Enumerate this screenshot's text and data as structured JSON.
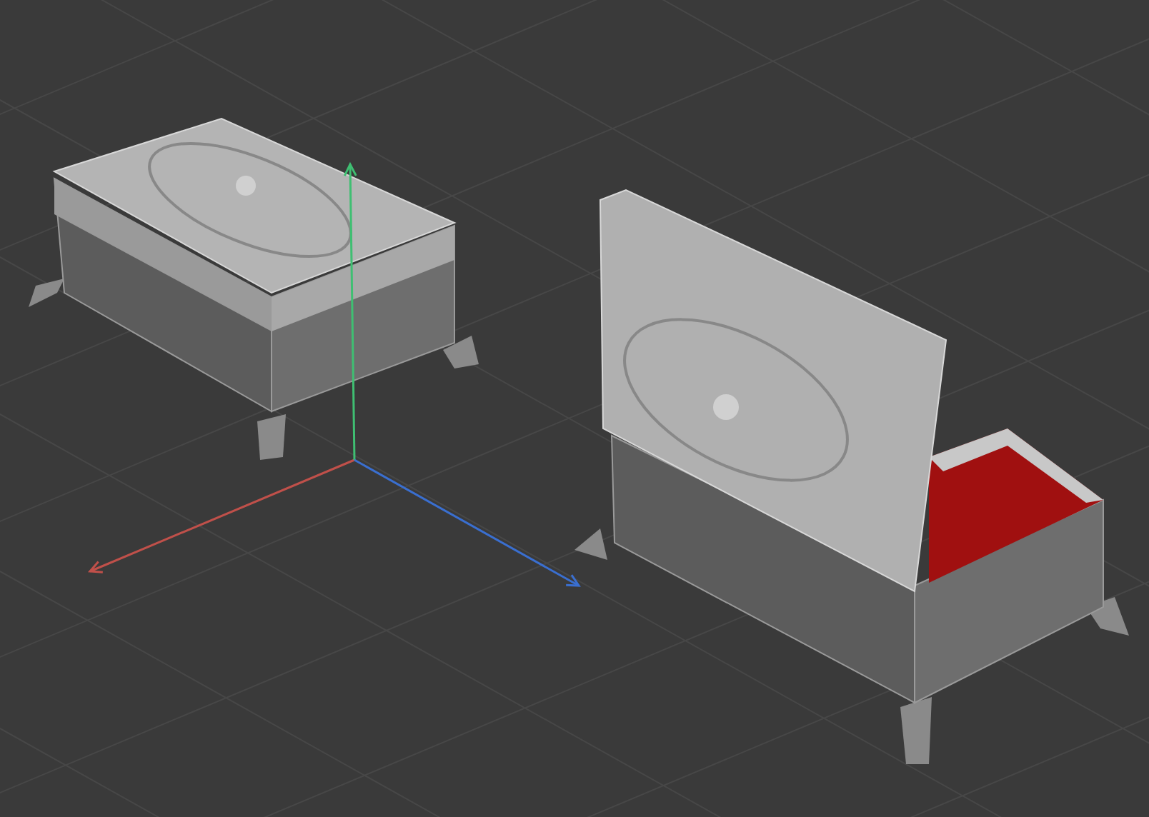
{
  "viewport": {
    "axes": [
      {
        "kind": "x",
        "color": "#c0504a"
      },
      {
        "kind": "y",
        "color": "#3fbf72"
      },
      {
        "kind": "z",
        "color": "#3a6fd0"
      }
    ],
    "objects": [
      {
        "kind": "closed-box"
      },
      {
        "kind": "open-box"
      }
    ]
  }
}
